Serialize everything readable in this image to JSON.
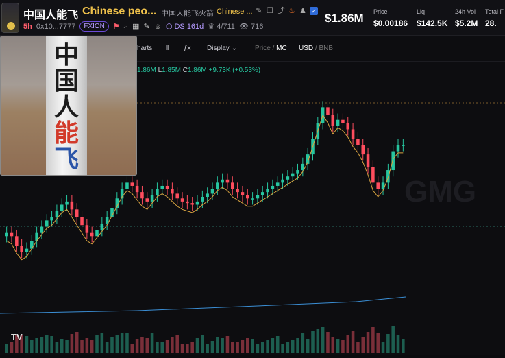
{
  "token": {
    "name_cn": "中国人能飞",
    "name_en": "Chinese peo...",
    "full_cn": "中国人能飞火箭",
    "full_en": "Chinese ...",
    "age": "5h",
    "address": "0x10...7777",
    "launchpad": "FXION",
    "ds_count": "161d",
    "holders_ratio": "4/711",
    "views": "716"
  },
  "stats": {
    "market_cap": "$1.86M",
    "price_label": "Price",
    "price": "$0.00186",
    "liq_label": "Liq",
    "liq": "$142.5K",
    "vol_label": "24h Vol",
    "vol": "$5.2M",
    "total_label": "Total F",
    "total": "28."
  },
  "toolbar": {
    "charts_label": "harts",
    "display_label": "Display",
    "price_mc_a": "Price",
    "price_mc_b": "MC",
    "usd_bnb_a": "USD",
    "usd_bnb_b": "BNB"
  },
  "ohlc": {
    "h": "1.86M",
    "l_key": "L",
    "l": "1.85M",
    "c_key": "C",
    "c": "1.86M",
    "change": "+9.73K (+0.53%)"
  },
  "pip": {
    "chars": [
      "中",
      "国",
      "人",
      "能",
      "飞"
    ]
  },
  "watermark": "GMG",
  "tv_logo": "TV",
  "colors": {
    "up": "#26c6a0",
    "down": "#ff4d5e",
    "accent": "#f0c24b",
    "purple": "#b59bff"
  },
  "chart_data": {
    "type": "candlestick",
    "x": [
      1,
      2,
      3,
      4,
      5,
      6,
      7,
      8,
      9,
      10,
      11,
      12,
      13,
      14,
      15,
      16,
      17,
      18,
      19,
      20,
      21,
      22,
      23,
      24,
      25,
      26,
      27,
      28,
      29,
      30,
      31,
      32,
      33,
      34,
      35,
      36,
      37,
      38,
      39,
      40,
      41,
      42,
      43,
      44,
      45,
      46,
      47,
      48,
      49,
      50,
      51,
      52,
      53,
      54,
      55,
      56,
      57,
      58,
      59,
      60,
      61,
      62,
      63,
      64,
      65,
      66,
      67,
      68,
      69,
      70,
      71,
      72,
      73,
      74,
      75,
      76,
      77,
      78,
      79,
      80
    ],
    "close": [
      1.3,
      1.28,
      1.22,
      1.18,
      1.2,
      1.25,
      1.3,
      1.34,
      1.38,
      1.4,
      1.44,
      1.48,
      1.5,
      1.45,
      1.4,
      1.35,
      1.3,
      1.28,
      1.32,
      1.36,
      1.4,
      1.46,
      1.52,
      1.58,
      1.62,
      1.6,
      1.56,
      1.52,
      1.5,
      1.54,
      1.58,
      1.6,
      1.58,
      1.55,
      1.52,
      1.5,
      1.49,
      1.48,
      1.5,
      1.53,
      1.55,
      1.58,
      1.62,
      1.64,
      1.62,
      1.58,
      1.56,
      1.54,
      1.52,
      1.52,
      1.54,
      1.56,
      1.58,
      1.6,
      1.62,
      1.64,
      1.66,
      1.68,
      1.7,
      1.74,
      1.8,
      1.9,
      2.0,
      2.1,
      2.05,
      1.98,
      2.02,
      2.0,
      1.96,
      1.9,
      1.86,
      1.8,
      1.72,
      1.62,
      1.58,
      1.62,
      1.7,
      1.82,
      1.86,
      1.86
    ]
  }
}
